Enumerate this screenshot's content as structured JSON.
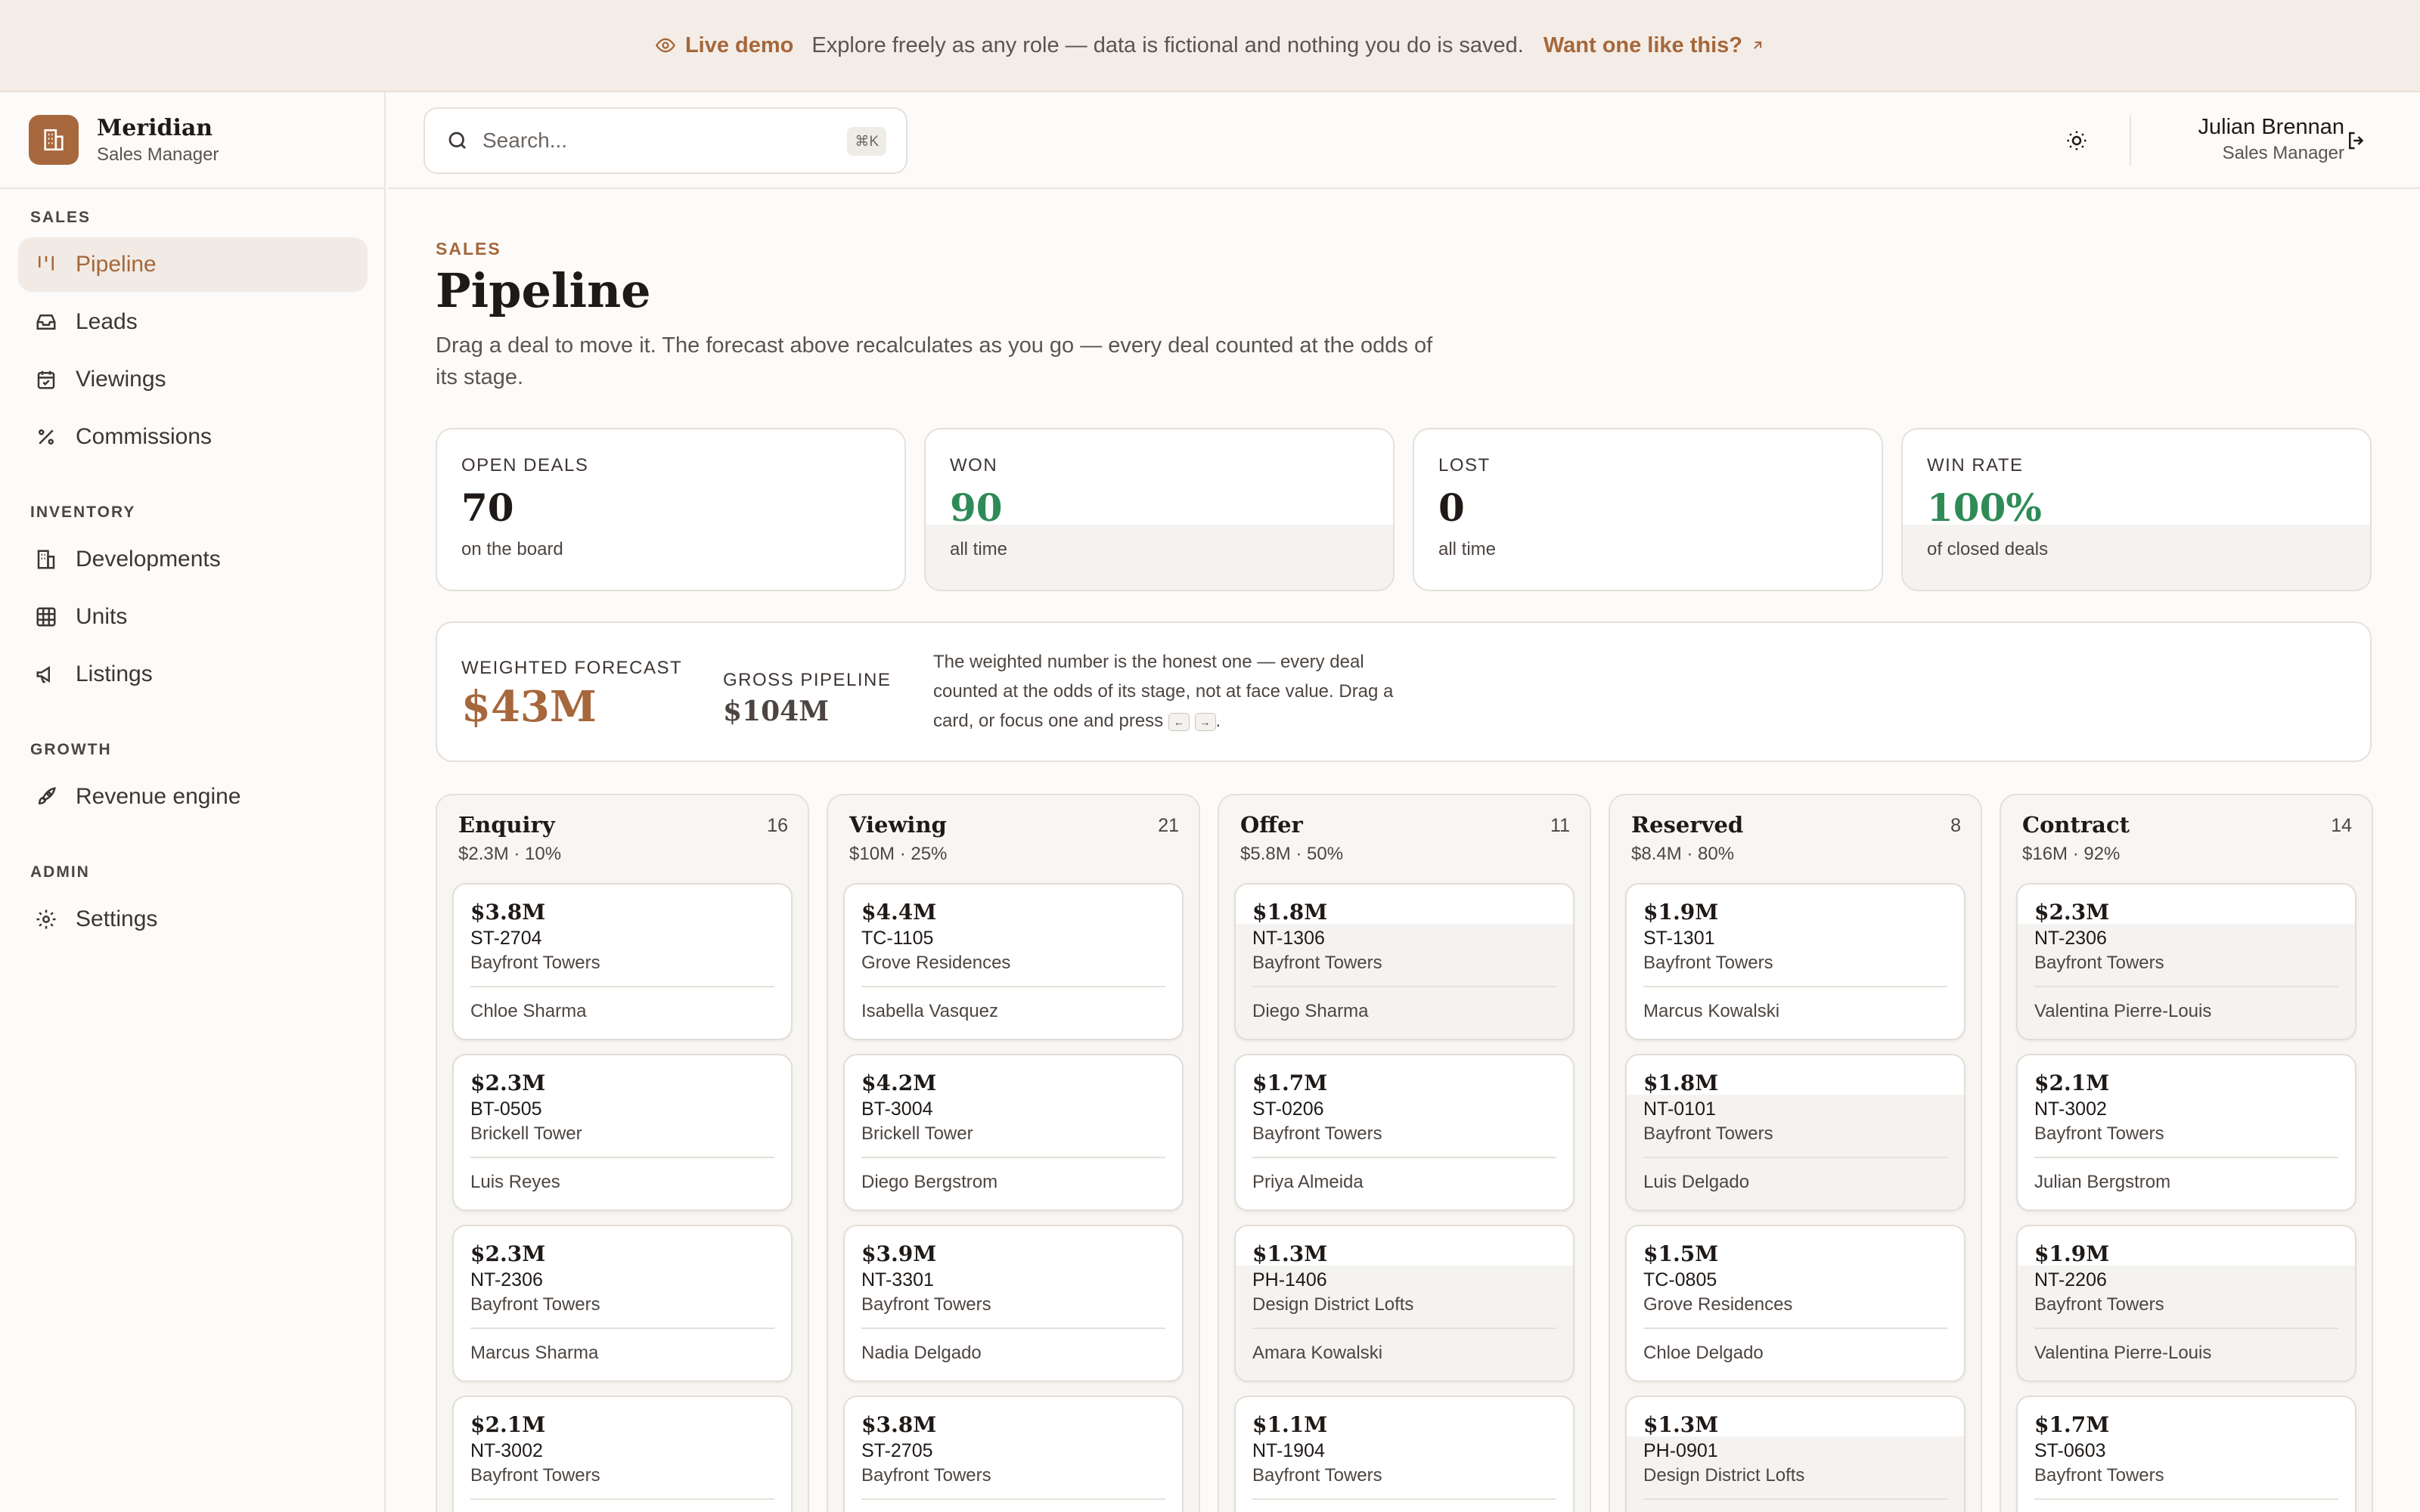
{
  "banner": {
    "live_label": "Live demo",
    "message": "Explore freely as any role — data is fictional and nothing you do is saved.",
    "cta": "Want one like this?"
  },
  "brand": {
    "name": "Meridian",
    "role": "Sales Manager"
  },
  "sidebar": {
    "sections": [
      {
        "label": "SALES"
      },
      {
        "label": "INVENTORY"
      },
      {
        "label": "GROWTH"
      },
      {
        "label": "ADMIN"
      }
    ],
    "items": [
      {
        "label": "Pipeline"
      },
      {
        "label": "Leads"
      },
      {
        "label": "Viewings"
      },
      {
        "label": "Commissions"
      },
      {
        "label": "Developments"
      },
      {
        "label": "Units"
      },
      {
        "label": "Listings"
      },
      {
        "label": "Revenue engine"
      },
      {
        "label": "Settings"
      }
    ]
  },
  "topbar": {
    "search_placeholder": "Search...",
    "search_shortcut": "⌘K",
    "user_name": "Julian Brennan",
    "user_role": "Sales Manager"
  },
  "page": {
    "kicker": "SALES",
    "title": "Pipeline",
    "description": "Drag a deal to move it. The forecast above recalculates as you go — every deal counted at the odds of its stage."
  },
  "stats": [
    {
      "label": "OPEN DEALS",
      "value": "70",
      "sub": "on the board"
    },
    {
      "label": "WON",
      "value": "90",
      "sub": "all time"
    },
    {
      "label": "LOST",
      "value": "0",
      "sub": "all time"
    },
    {
      "label": "WIN RATE",
      "value": "100%",
      "sub": "of closed deals"
    }
  ],
  "forecast": {
    "weighted_label": "WEIGHTED FORECAST",
    "weighted_value": "$43M",
    "gross_label": "GROSS PIPELINE",
    "gross_value": "$104M",
    "note_a": "The weighted number is the honest one — every deal counted at the odds of its stage, not at face value. Drag a card, or focus one and press",
    "key_left": "←",
    "key_right": "→",
    "note_end": "."
  },
  "columns": [
    {
      "title": "Enquiry",
      "count": "16",
      "meta": "$2.3M · 10%",
      "cards": [
        {
          "amount": "$3.8M",
          "unit": "ST-2704",
          "development": "Bayfront Towers",
          "agent": "Chloe Sharma"
        },
        {
          "amount": "$2.3M",
          "unit": "BT-0505",
          "development": "Brickell Tower",
          "agent": "Luis Reyes"
        },
        {
          "amount": "$2.3M",
          "unit": "NT-2306",
          "development": "Bayfront Towers",
          "agent": "Marcus Sharma"
        },
        {
          "amount": "$2.1M",
          "unit": "NT-3002",
          "development": "Bayfront Towers",
          "agent": ""
        }
      ]
    },
    {
      "title": "Viewing",
      "count": "21",
      "meta": "$10M · 25%",
      "cards": [
        {
          "amount": "$4.4M",
          "unit": "TC-1105",
          "development": "Grove Residences",
          "agent": "Isabella Vasquez"
        },
        {
          "amount": "$4.2M",
          "unit": "BT-3004",
          "development": "Brickell Tower",
          "agent": "Diego Bergstrom"
        },
        {
          "amount": "$3.9M",
          "unit": "NT-3301",
          "development": "Bayfront Towers",
          "agent": "Nadia Delgado"
        },
        {
          "amount": "$3.8M",
          "unit": "ST-2705",
          "development": "Bayfront Towers",
          "agent": ""
        }
      ]
    },
    {
      "title": "Offer",
      "count": "11",
      "meta": "$5.8M · 50%",
      "cards": [
        {
          "amount": "$1.8M",
          "unit": "NT-1306",
          "development": "Bayfront Towers",
          "agent": "Diego Sharma"
        },
        {
          "amount": "$1.7M",
          "unit": "ST-0206",
          "development": "Bayfront Towers",
          "agent": "Priya Almeida"
        },
        {
          "amount": "$1.3M",
          "unit": "PH-1406",
          "development": "Design District Lofts",
          "agent": "Amara Kowalski"
        },
        {
          "amount": "$1.1M",
          "unit": "NT-1904",
          "development": "Bayfront Towers",
          "agent": ""
        }
      ]
    },
    {
      "title": "Reserved",
      "count": "8",
      "meta": "$8.4M · 80%",
      "cards": [
        {
          "amount": "$1.9M",
          "unit": "ST-1301",
          "development": "Bayfront Towers",
          "agent": "Marcus Kowalski"
        },
        {
          "amount": "$1.8M",
          "unit": "NT-0101",
          "development": "Bayfront Towers",
          "agent": "Luis Delgado"
        },
        {
          "amount": "$1.5M",
          "unit": "TC-0805",
          "development": "Grove Residences",
          "agent": "Chloe Delgado"
        },
        {
          "amount": "$1.3M",
          "unit": "PH-0901",
          "development": "Design District Lofts",
          "agent": ""
        }
      ]
    },
    {
      "title": "Contract",
      "count": "14",
      "meta": "$16M · 92%",
      "cards": [
        {
          "amount": "$2.3M",
          "unit": "NT-2306",
          "development": "Bayfront Towers",
          "agent": "Valentina Pierre-Louis"
        },
        {
          "amount": "$2.1M",
          "unit": "NT-3002",
          "development": "Bayfront Towers",
          "agent": "Julian Bergstrom"
        },
        {
          "amount": "$1.9M",
          "unit": "NT-2206",
          "development": "Bayfront Towers",
          "agent": "Valentina Pierre-Louis"
        },
        {
          "amount": "$1.7M",
          "unit": "ST-0603",
          "development": "Bayfront Towers",
          "agent": ""
        }
      ]
    }
  ],
  "colors": {
    "accent": "#a5673b",
    "success": "#2e8b57",
    "banner_bg": "#f4ede7"
  },
  "icons": [
    "eye-icon",
    "arrow-up-right-icon",
    "building-icon",
    "pipeline-icon",
    "inbox-icon",
    "calendar-icon",
    "percent-icon",
    "grid-icon",
    "megaphone-icon",
    "rocket-icon",
    "gear-icon",
    "search-icon",
    "sun-icon",
    "logout-icon"
  ]
}
